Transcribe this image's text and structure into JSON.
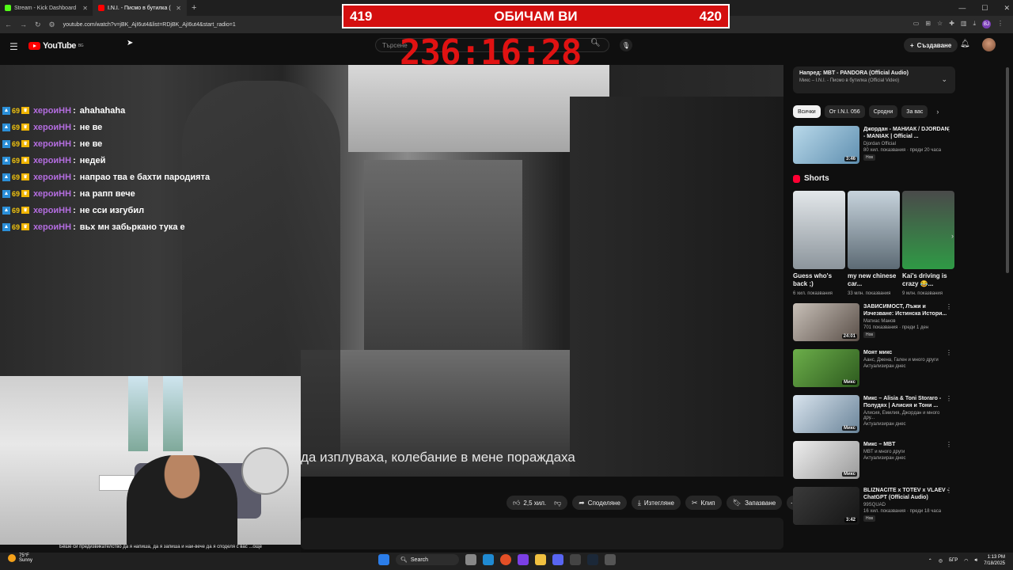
{
  "browser": {
    "tabs": [
      {
        "title": "Stream - Kick Dashboard",
        "color": "#53fc18"
      },
      {
        "title": "I.N.I. - Писмо в бутилка (",
        "color": "#ff0000"
      }
    ],
    "url": "youtube.com/watch?v=jBK_AjI6ut4&list=RDjBK_AjI6ut4&start_radio=1",
    "profile_initials": "BJ"
  },
  "overlay": {
    "score_left": "419",
    "score_title": "ОБИЧАМ ВИ",
    "score_right": "420",
    "timer": "236:16:28"
  },
  "youtube": {
    "logo_text": "YouTube",
    "logo_sup": "BG",
    "search_placeholder": "Търсене",
    "create_label": "Създаване"
  },
  "video": {
    "subtitle": "да изплуваха, колебание в мене пораждаха"
  },
  "chat": {
    "level": "69",
    "messages": [
      {
        "user": "хероиНН",
        "text": "ahahahaha"
      },
      {
        "user": "хероиНН",
        "text": "не ве"
      },
      {
        "user": "хероиНН",
        "text": "не ве"
      },
      {
        "user": "хероиНН",
        "text": "недей"
      },
      {
        "user": "хероиНН",
        "text": "напрао тва е бахти пародията"
      },
      {
        "user": "хероиНН",
        "text": "на рапп вече"
      },
      {
        "user": "хероиНН",
        "text": "не сси изгубил"
      },
      {
        "user": "хероиНН",
        "text": "вьх мн забьркано тука е"
      }
    ]
  },
  "webcam": {
    "caption": "Беше си предизвикателство да я напиша, да я запиша и най-вече да я споделя с вас ...още"
  },
  "actions": {
    "like": "2,5 хил.",
    "share": "Споделяне",
    "download": "Изтегляне",
    "clip": "Клип",
    "save": "Запазване"
  },
  "sidebar": {
    "next_title": "Напред: MBT - PANDORA (Official Audio)",
    "next_sub": "Микс – I.N.I. - Писмо в бутилка (Official Video)",
    "chips": [
      "Всички",
      "От I.N.I. 056",
      "Сродни",
      "За вас"
    ],
    "videos_top": [
      {
        "title": "Джордан - МАНИАК / DJORDAN - MANIAK | Official ...",
        "channel": "Djordan Official",
        "meta": "80 хил. показвания · преди 20 часа",
        "tag": "Нов",
        "duration": "3:46",
        "color": "#7fb8d8"
      }
    ],
    "shorts_heading": "Shorts",
    "shorts": [
      {
        "title": "Guess who's back ;)",
        "views": "6 хил. показвания",
        "color": "#bfc6cf"
      },
      {
        "title": "my new chinese car...",
        "views": "33 млн. показвания",
        "color": "#8a9aa8"
      },
      {
        "title": "Kai's driving is crazy 😂...",
        "views": "9 млн. показвания",
        "color": "#3f9a4c"
      }
    ],
    "videos": [
      {
        "title": "ЗАВИСИМОСТ, Лъжи и Изчезване: Истинска Истори...",
        "channel": "Матиас Манов",
        "meta": "701 показвания · преди 1 ден",
        "tag": "Нов",
        "duration": "24:01",
        "color": "#9a8f88"
      },
      {
        "title": "Моят микс",
        "channel": "Аанс, Джена, Гален и много други",
        "meta": "Актуализиран днес",
        "tag": "",
        "duration": "Микс",
        "color": "#4f8a3a"
      },
      {
        "title": "Микс – Alisia & Toni Storaro - Полудях | Алисия и Тони ...",
        "channel": "Алисия, Емилия, Джордан и много дру...",
        "meta": "Актуализиран днес",
        "tag": "",
        "duration": "Микс",
        "color": "#9bb0c4"
      },
      {
        "title": "Микс – MBT",
        "channel": "MBT и много други",
        "meta": "Актуализиран днес",
        "tag": "",
        "duration": "Микс",
        "color": "#d7d7d7"
      },
      {
        "title": "BLIZNACITE x TOTEV x VLAEV - ChatGPT (Official Audio)",
        "channel": "99SQUAD",
        "meta": "16 хил. показвания · преди 18 часа",
        "tag": "Нов",
        "duration": "3:42",
        "color": "#2a2a2a"
      }
    ]
  },
  "taskbar": {
    "temp": "75°F",
    "weather": "Sunny",
    "search": "Search",
    "lang": "БГР",
    "time": "1:13 PM",
    "date": "7/18/2025"
  }
}
